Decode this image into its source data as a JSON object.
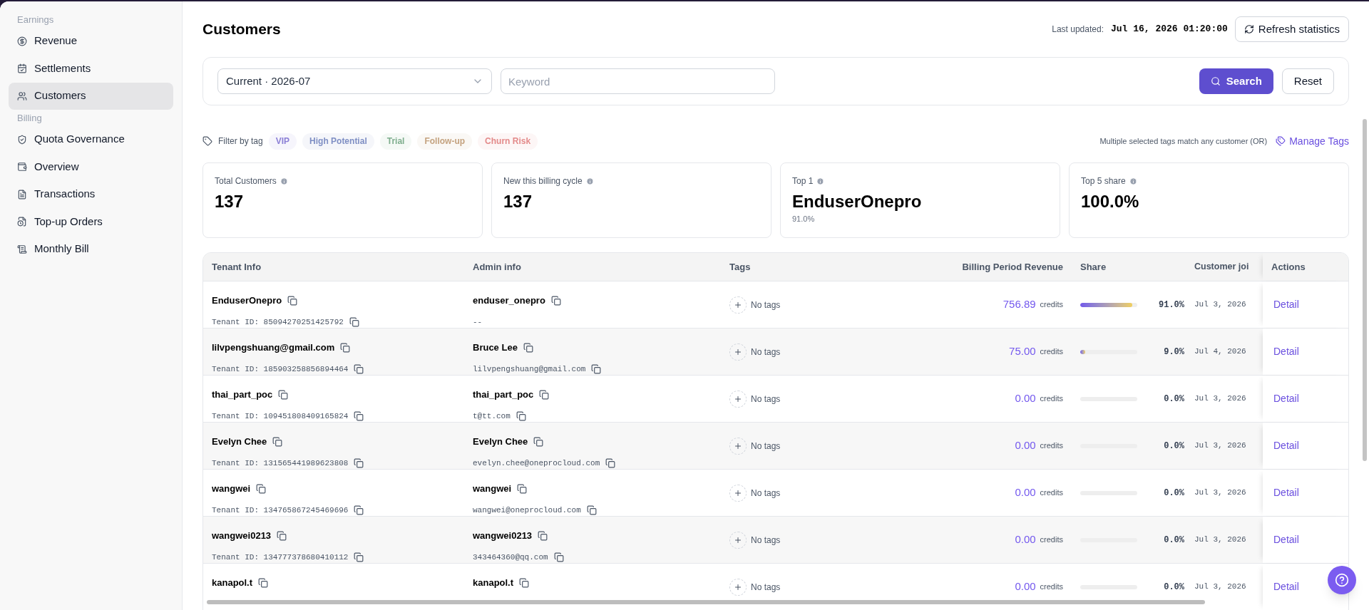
{
  "sidebar": {
    "groups": [
      {
        "label": "Earnings",
        "items": [
          {
            "label": "Revenue",
            "selected": false
          },
          {
            "label": "Settlements",
            "selected": false
          },
          {
            "label": "Customers",
            "selected": true
          }
        ]
      },
      {
        "label": "Billing",
        "items": [
          {
            "label": "Quota Governance",
            "selected": false
          },
          {
            "label": "Overview",
            "selected": false
          },
          {
            "label": "Transactions",
            "selected": false
          },
          {
            "label": "Top-up Orders",
            "selected": false
          },
          {
            "label": "Monthly Bill",
            "selected": false
          }
        ]
      }
    ]
  },
  "header": {
    "title": "Customers",
    "last_updated_label": "Last updated:",
    "last_updated_value": "Jul 16, 2026 01:20:00",
    "refresh_button": "Refresh statistics"
  },
  "filters": {
    "period": "Current · 2026-07",
    "keyword": {
      "placeholder": "Keyword"
    },
    "search_button": "Search",
    "reset_button": "Reset"
  },
  "tag_filter": {
    "label": "Filter by tag",
    "tags": [
      {
        "label": "VIP",
        "color": "#8b7fd6",
        "selected": false
      },
      {
        "label": "High Potential",
        "color": "#7f8fc4",
        "selected": false
      },
      {
        "label": "Trial",
        "color": "#7fae8e",
        "selected": false
      },
      {
        "label": "Follow-up",
        "color": "#c4a27f",
        "selected": false
      },
      {
        "label": "Churn Risk",
        "color": "#e38a8a",
        "selected": false
      }
    ],
    "hint": "Multiple selected tags match any customer (OR)",
    "manage_button": "Manage Tags"
  },
  "stats": [
    {
      "label": "Total Customers",
      "value": "137"
    },
    {
      "label": "New this billing cycle",
      "value": "137"
    },
    {
      "label": "Top 1",
      "value": "EnduserOnepro",
      "sub": "91.0%"
    },
    {
      "label": "Top 5 share",
      "value": "100.0%"
    }
  ],
  "table": {
    "columns": [
      "Tenant Info",
      "Admin info",
      "Tags",
      "Billing Period Revenue",
      "Share",
      "Customer joi",
      "Actions"
    ],
    "rows": [
      {
        "tenant": "EnduserOnepro",
        "tenant_id": "Tenant ID: 85094270251425792",
        "admin": "enduser_onepro",
        "admin_sub": "--",
        "tags": "No tags",
        "revenue": "756.89",
        "unit": "credits",
        "level": 0.91,
        "share": "91.0%",
        "joined": "Jul 3, 2026",
        "action": "Detail"
      },
      {
        "tenant": "lilvpengshuang@gmail.com",
        "tenant_id": "Tenant ID: 185903258856894464",
        "admin": "Bruce Lee",
        "admin_sub": "lilvpengshuang@gmail.com",
        "tags": "No tags",
        "revenue": "75.00",
        "unit": "credits",
        "level": 0.09,
        "share": "9.0%",
        "joined": "Jul 4, 2026",
        "action": "Detail"
      },
      {
        "tenant": "thai_part_poc",
        "tenant_id": "Tenant ID: 109451808409165824",
        "admin": "thai_part_poc",
        "admin_sub": "t@tt.com",
        "tags": "No tags",
        "revenue": "0.00",
        "unit": "credits",
        "level": 0,
        "share": "0.0%",
        "joined": "Jul 3, 2026",
        "action": "Detail"
      },
      {
        "tenant": "Evelyn Chee",
        "tenant_id": "Tenant ID: 131565441989623808",
        "admin": "Evelyn Chee",
        "admin_sub": "evelyn.chee@oneprocloud.com",
        "tags": "No tags",
        "revenue": "0.00",
        "unit": "credits",
        "level": 0,
        "share": "0.0%",
        "joined": "Jul 3, 2026",
        "action": "Detail"
      },
      {
        "tenant": "wangwei",
        "tenant_id": "Tenant ID: 134765867245469696",
        "admin": "wangwei",
        "admin_sub": "wangwei@oneprocloud.com",
        "tags": "No tags",
        "revenue": "0.00",
        "unit": "credits",
        "level": 0,
        "share": "0.0%",
        "joined": "Jul 3, 2026",
        "action": "Detail"
      },
      {
        "tenant": "wangwei0213",
        "tenant_id": "Tenant ID: 134777378680410112",
        "admin": "wangwei0213",
        "admin_sub": "343464360@qq.com",
        "tags": "No tags",
        "revenue": "0.00",
        "unit": "credits",
        "level": 0,
        "share": "0.0%",
        "joined": "Jul 3, 2026",
        "action": "Detail"
      },
      {
        "tenant": "kanapol.t",
        "admin": "kanapol.t",
        "tags": "No tags",
        "revenue": "0.00",
        "unit": "credits",
        "level": 0,
        "share": "0.0%",
        "joined": "Jul 3, 2026",
        "action": "Detail"
      }
    ]
  }
}
